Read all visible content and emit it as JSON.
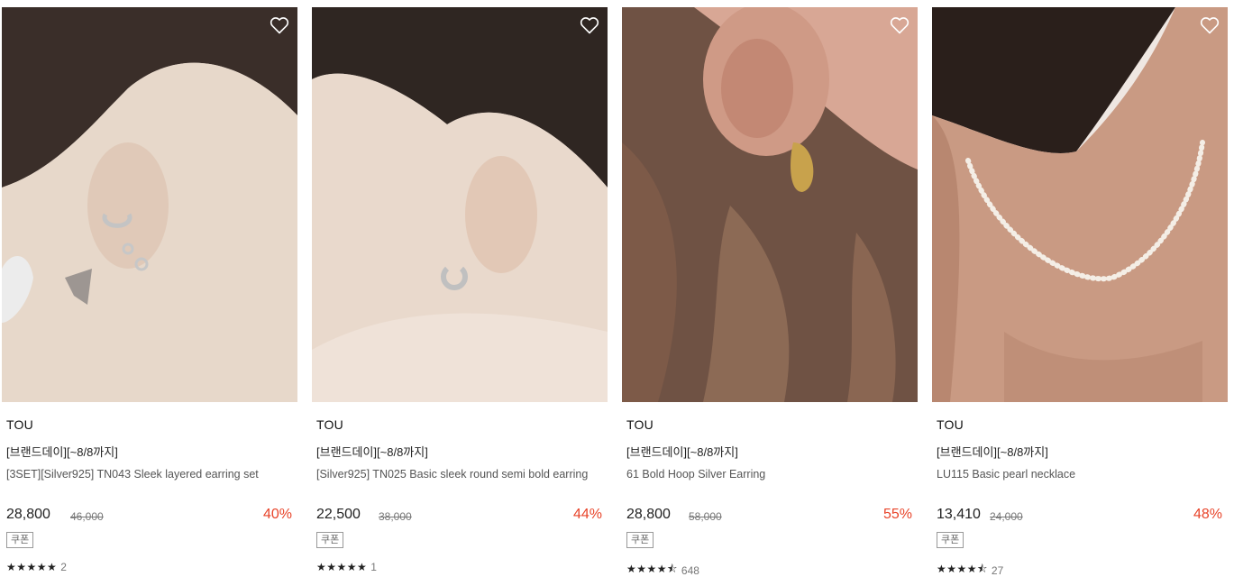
{
  "products": [
    {
      "brand": "TOU",
      "promo": "[브랜드데이][~8/8까지]",
      "name": "[3SET][Silver925] TN043 Sleek layered earring set",
      "price": "28,800",
      "original_price": "46,000",
      "discount": "40%",
      "coupon_label": "쿠폰",
      "rating": 5,
      "stars": "★★★★★",
      "review_count": "2"
    },
    {
      "brand": "TOU",
      "promo": "[브랜드데이][~8/8까지]",
      "name": "[Silver925] TN025 Basic sleek round semi bold earring",
      "price": "22,500",
      "original_price": "38,000",
      "discount": "44%",
      "coupon_label": "쿠폰",
      "rating": 5,
      "stars": "★★★★★",
      "review_count": "1"
    },
    {
      "brand": "TOU",
      "promo": "[브랜드데이][~8/8까지]",
      "name": "61 Bold Hoop Silver Earring",
      "price": "28,800",
      "original_price": "58,000",
      "discount": "55%",
      "coupon_label": "쿠폰",
      "rating": 4.5,
      "stars": "★★★★⯪",
      "review_count": "648"
    },
    {
      "brand": "TOU",
      "promo": "[브랜드데이][~8/8까지]",
      "name": "LU115 Basic pearl necklace",
      "price": "13,410",
      "original_price": "24,000",
      "discount": "48%",
      "coupon_label": "쿠폰",
      "rating": 4.5,
      "stars": "★★★★⯪",
      "review_count": "27"
    }
  ],
  "colors": {
    "discount": "#e8442a",
    "text": "#222222",
    "muted": "#777777"
  },
  "icons": {
    "wishlist": "heart-outline-icon",
    "rating": "star-icon"
  }
}
